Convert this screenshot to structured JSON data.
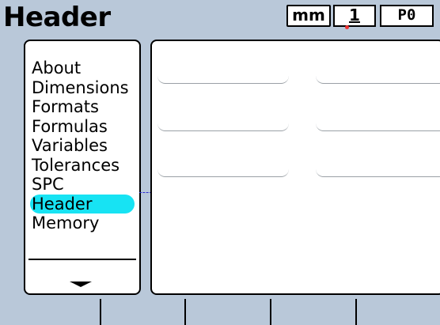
{
  "screen": {
    "title": "Header"
  },
  "status_bar": {
    "units": "mm",
    "part": "1",
    "program": "P0"
  },
  "menu": {
    "items": [
      {
        "label": "About"
      },
      {
        "label": "Dimensions"
      },
      {
        "label": "Formats"
      },
      {
        "label": "Formulas"
      },
      {
        "label": "Variables"
      },
      {
        "label": "Tolerances"
      },
      {
        "label": "SPC"
      },
      {
        "label": "Header",
        "selected": true
      },
      {
        "label": "Memory"
      }
    ],
    "scroll_indicator": "down-arrow-icon"
  },
  "content": {
    "fields": [
      {
        "value": ""
      },
      {
        "value": ""
      },
      {
        "value": ""
      },
      {
        "value": ""
      },
      {
        "value": ""
      },
      {
        "value": ""
      }
    ]
  },
  "softkeys": [
    {
      "label": ""
    },
    {
      "label": ""
    },
    {
      "label": ""
    },
    {
      "label": ""
    },
    {
      "label": ""
    }
  ],
  "colors": {
    "background": "#b9c8d9",
    "selection": "#17e3f3",
    "panel": "#ffffff"
  }
}
